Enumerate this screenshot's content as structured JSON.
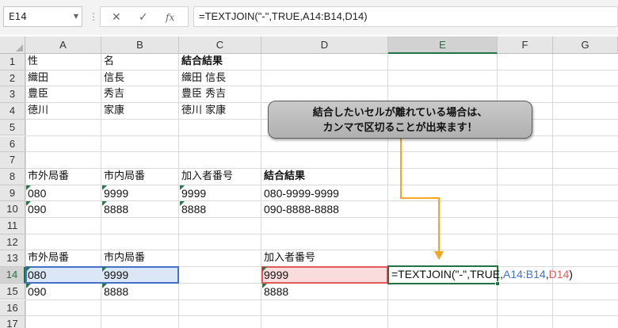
{
  "formula_bar": {
    "name_box": "E14",
    "dropdown_icon": "chevron-down-icon",
    "cancel_icon": "✕",
    "enter_icon": "✓",
    "fx_label": "fx",
    "formula": "=TEXTJOIN(\"-\",TRUE,A14:B14,D14)"
  },
  "columns": [
    "A",
    "B",
    "C",
    "D",
    "E",
    "F",
    "G"
  ],
  "selected_column": "E",
  "rows": [
    "1",
    "2",
    "3",
    "4",
    "5",
    "6",
    "7",
    "8",
    "9",
    "10",
    "11",
    "12",
    "13",
    "14",
    "15",
    "16",
    "17"
  ],
  "selected_row": "14",
  "cells": {
    "A1": "性",
    "B1": "名",
    "C1": "結合結果",
    "A2": "織田",
    "B2": "信長",
    "C2": "織田 信長",
    "A3": "豊臣",
    "B3": "秀吉",
    "C3": "豊臣 秀吉",
    "A4": "徳川",
    "B4": "家康",
    "C4": "徳川 家康",
    "A8": "市外局番",
    "B8": "市内局番",
    "C8": "加入者番号",
    "D8": "結合結果",
    "A9": "080",
    "B9": "9999",
    "C9": "9999",
    "D9": "080-9999-9999",
    "A10": "090",
    "B10": "8888",
    "C10": "8888",
    "D10": "090-8888-8888",
    "A13": "市外局番",
    "B13": "市内局番",
    "D13": "加入者番号",
    "A14": "080",
    "B14": "9999",
    "D14": "9999",
    "A15": "090",
    "B15": "8888",
    "D15": "8888"
  },
  "editing": {
    "prefix": "=TEXTJOIN(\"-\",TRUE,",
    "ref1": "A14:B14",
    "sep": ",",
    "ref2": "D14",
    "suffix": ")"
  },
  "callout": {
    "line1": "結合したいセルが離れている場合は、",
    "line2": "カンマで区切ることが出来ます！"
  },
  "colors": {
    "excel_green": "#217346",
    "ref_blue": "#4472c4",
    "ref_red": "#e05a5a",
    "arrow_orange": "#f5a623"
  }
}
